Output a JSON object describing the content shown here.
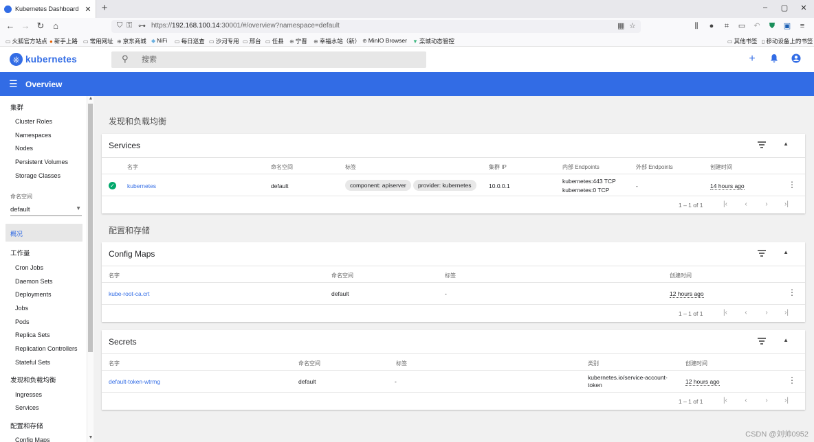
{
  "browser": {
    "tab_title": "Kubernetes Dashboard",
    "tab_close": "✕",
    "new_tab": "+",
    "url_prefix": "https://",
    "url_host": "192.168.100.14",
    "url_rest": ":30001/#/overview?namespace=default",
    "bookmarks": [
      {
        "label": "火狐官方站点",
        "icon": "folder-icon"
      },
      {
        "label": "新手上路",
        "icon": "firefox-icon"
      },
      {
        "label": "常用网址",
        "icon": "folder-icon"
      },
      {
        "label": "京东商城",
        "icon": "globe-icon"
      },
      {
        "label": "NiFi",
        "icon": "nifi-icon"
      },
      {
        "label": "每日巡查",
        "icon": "folder-icon"
      },
      {
        "label": "沙河专用",
        "icon": "folder-icon"
      },
      {
        "label": "邢台",
        "icon": "folder-icon"
      },
      {
        "label": "任县",
        "icon": "folder-icon"
      },
      {
        "label": "宁晋",
        "icon": "globe-icon"
      },
      {
        "label": "幸福水站（新）",
        "icon": "globe-icon"
      },
      {
        "label": "MinIO Browser",
        "icon": "globe-icon"
      },
      {
        "label": "栾城动态管控",
        "icon": "vue-icon"
      }
    ],
    "bookmarks_right": [
      {
        "label": "其他书签",
        "icon": "folder-icon"
      },
      {
        "label": "移动设备上的书签",
        "icon": "mobile-icon"
      }
    ]
  },
  "header": {
    "app_name": "kubernetes",
    "search_placeholder": "搜索"
  },
  "toolbar": {
    "title": "Overview"
  },
  "sidebar": {
    "cluster_heading": "集群",
    "cluster_items": [
      "Cluster Roles",
      "Namespaces",
      "Nodes",
      "Persistent Volumes",
      "Storage Classes"
    ],
    "namespace_label": "命名空间",
    "namespace_value": "default",
    "overview_label": "概况",
    "workloads_heading": "工作量",
    "workload_items": [
      "Cron Jobs",
      "Daemon Sets",
      "Deployments",
      "Jobs",
      "Pods",
      "Replica Sets",
      "Replication Controllers",
      "Stateful Sets"
    ],
    "discovery_heading": "发现和负载均衡",
    "discovery_items": [
      "Ingresses",
      "Services"
    ],
    "config_heading": "配置和存储",
    "config_items": [
      "Config Maps"
    ]
  },
  "main": {
    "discovery_heading": "发现和负载均衡",
    "config_heading": "配置和存储",
    "services": {
      "title": "Services",
      "columns": [
        "名字",
        "命名空间",
        "标签",
        "集群 IP",
        "内部 Endpoints",
        "外部 Endpoints",
        "创建时间"
      ],
      "rows": [
        {
          "name": "kubernetes",
          "namespace": "default",
          "labels": [
            "component: apiserver",
            "provider: kubernetes"
          ],
          "cluster_ip": "10.0.0.1",
          "internal_endpoints": [
            "kubernetes:443 TCP",
            "kubernetes:0 TCP"
          ],
          "external_endpoints": "-",
          "created": "14 hours ago"
        }
      ],
      "pager": "1 – 1 of 1"
    },
    "config_maps": {
      "title": "Config Maps",
      "columns": [
        "名字",
        "命名空间",
        "标签",
        "创建时间"
      ],
      "rows": [
        {
          "name": "kube-root-ca.crt",
          "namespace": "default",
          "labels": "-",
          "created": "12 hours ago"
        }
      ],
      "pager": "1 – 1 of 1"
    },
    "secrets": {
      "title": "Secrets",
      "columns": [
        "名字",
        "命名空间",
        "标签",
        "类别",
        "创建时间"
      ],
      "rows": [
        {
          "name": "default-token-wtrmg",
          "namespace": "default",
          "labels": "-",
          "type": [
            "kubernetes.io/service-account-",
            "token"
          ],
          "created": "12 hours ago"
        }
      ],
      "pager": "1 – 1 of 1"
    }
  },
  "watermark": "CSDN @刘帅0952",
  "colors": {
    "accent": "#326ce5",
    "ok": "#00a86b"
  }
}
